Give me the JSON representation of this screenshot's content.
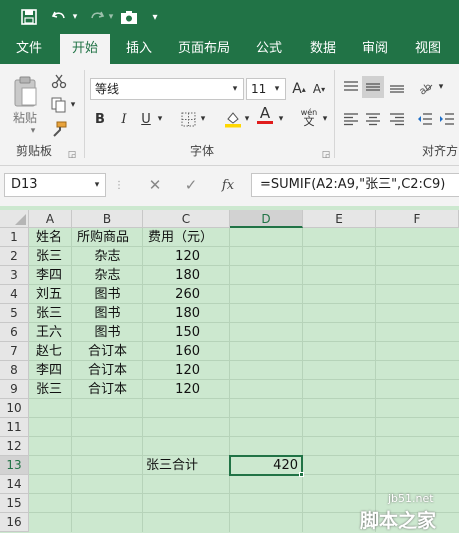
{
  "quick_access": {
    "save_icon": "save-icon",
    "undo_icon": "undo-icon",
    "redo_icon": "redo-icon",
    "camera_icon": "camera-icon",
    "customize_icon": "customize-icon"
  },
  "tabs": [
    "文件",
    "开始",
    "插入",
    "页面布局",
    "公式",
    "数据",
    "审阅",
    "视图"
  ],
  "ribbon": {
    "clipboard": {
      "paste_label": "粘贴",
      "group_label": "剪贴板"
    },
    "font": {
      "font_name": "等线",
      "font_size": "11",
      "bold": "B",
      "italic": "I",
      "underline": "U",
      "font_color_glyph": "A",
      "phonetic_glyph": "wén",
      "group_label": "字体"
    },
    "alignment": {
      "group_label": "对齐方"
    }
  },
  "formula_bar": {
    "name_box": "D13",
    "fx": "fx",
    "formula": "=SUMIF(A2:A9,\"张三\",C2:C9)"
  },
  "sheet": {
    "columns": [
      "A",
      "B",
      "C",
      "D",
      "E",
      "F"
    ],
    "rows": [
      "1",
      "2",
      "3",
      "4",
      "5",
      "6",
      "7",
      "8",
      "9",
      "10",
      "11",
      "12",
      "13",
      "14",
      "15",
      "16"
    ],
    "header_row": [
      "姓名",
      "所购商品",
      "费用（元）"
    ],
    "data": [
      [
        "张三",
        "杂志",
        "120"
      ],
      [
        "李四",
        "杂志",
        "180"
      ],
      [
        "刘五",
        "图书",
        "260"
      ],
      [
        "张三",
        "图书",
        "180"
      ],
      [
        "王六",
        "图书",
        "150"
      ],
      [
        "赵七",
        "合订本",
        "160"
      ],
      [
        "李四",
        "合订本",
        "120"
      ],
      [
        "张三",
        "合订本",
        "120"
      ]
    ],
    "summary_label": "张三合计",
    "summary_value": "420",
    "selected_cell": "D13"
  },
  "watermark": {
    "site": "jb51.net",
    "name": "脚本之家"
  },
  "colors": {
    "excel_green": "#217346",
    "sheet_bg": "#cce8cf",
    "ribbon_bg": "#f3f3f3"
  }
}
